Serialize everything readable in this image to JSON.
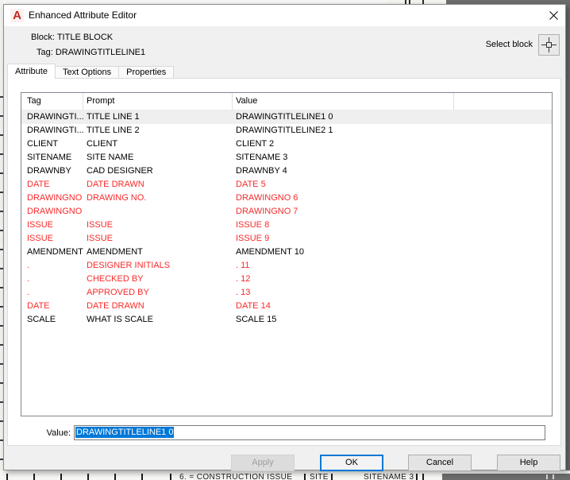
{
  "window": {
    "title": "Enhanced Attribute Editor",
    "app_icon_letter": "A"
  },
  "header": {
    "block_label": "Block:",
    "block_value": "TITLE BLOCK",
    "tag_label": "Tag:",
    "tag_value": "DRAWINGTITLELINE1",
    "select_block_label": "Select block"
  },
  "tabs": [
    {
      "label": "Attribute",
      "active": true
    },
    {
      "label": "Text Options",
      "active": false
    },
    {
      "label": "Properties",
      "active": false
    }
  ],
  "table": {
    "columns": [
      "Tag",
      "Prompt",
      "Value"
    ],
    "rows": [
      {
        "tag": "DRAWINGTI...",
        "prompt": "TITLE LINE 1",
        "value": "DRAWINGTITLELINE1 0",
        "color": "black",
        "selected": true
      },
      {
        "tag": "DRAWINGTI...",
        "prompt": "TITLE LINE 2",
        "value": "DRAWINGTITLELINE2 1",
        "color": "black"
      },
      {
        "tag": "CLIENT",
        "prompt": "CLIENT",
        "value": "CLIENT 2",
        "color": "black"
      },
      {
        "tag": "SITENAME",
        "prompt": "SITE NAME",
        "value": "SITENAME 3",
        "color": "black"
      },
      {
        "tag": "DRAWNBY",
        "prompt": "CAD DESIGNER",
        "value": "DRAWNBY 4",
        "color": "black"
      },
      {
        "tag": "DATE",
        "prompt": "DATE DRAWN",
        "value": "DATE 5",
        "color": "red"
      },
      {
        "tag": "DRAWINGNO",
        "prompt": "DRAWING NO.",
        "value": "DRAWINGNO 6",
        "color": "red"
      },
      {
        "tag": "DRAWINGNO",
        "prompt": "",
        "value": "DRAWINGNO 7",
        "color": "red"
      },
      {
        "tag": "ISSUE",
        "prompt": "ISSUE",
        "value": "ISSUE 8",
        "color": "red"
      },
      {
        "tag": "ISSUE",
        "prompt": "ISSUE",
        "value": "ISSUE 9",
        "color": "red"
      },
      {
        "tag": "AMENDMENT",
        "prompt": "AMENDMENT",
        "value": "AMENDMENT 10",
        "color": "black"
      },
      {
        "tag": ".",
        "prompt": "DESIGNER INITIALS",
        "value": ". 11",
        "color": "red"
      },
      {
        "tag": ".",
        "prompt": "CHECKED BY",
        "value": ". 12",
        "color": "red"
      },
      {
        "tag": ".",
        "prompt": "APPROVED BY",
        "value": ". 13",
        "color": "red"
      },
      {
        "tag": "DATE",
        "prompt": "DATE DRAWN",
        "value": "DATE 14",
        "color": "red"
      },
      {
        "tag": "SCALE",
        "prompt": "WHAT IS SCALE",
        "value": "SCALE 15",
        "color": "black"
      }
    ]
  },
  "value_editor": {
    "label": "Value:",
    "value": "DRAWINGTITLELINE1 0",
    "text_selected": true
  },
  "buttons": {
    "apply": "Apply",
    "ok": "OK",
    "cancel": "Cancel",
    "help": "Help"
  },
  "colors": {
    "accent": "#0078d7",
    "attribute_red": "#fa2a2a",
    "selection_blue": "#0078d7",
    "dialog_bg": "#f0f0f0",
    "background_dark": "#6d6d6d"
  },
  "background_drawing": {
    "bottom_texts": [
      "6. = CONSTRUCTION ISSUE",
      "SITE",
      "SITENAME 3"
    ]
  }
}
